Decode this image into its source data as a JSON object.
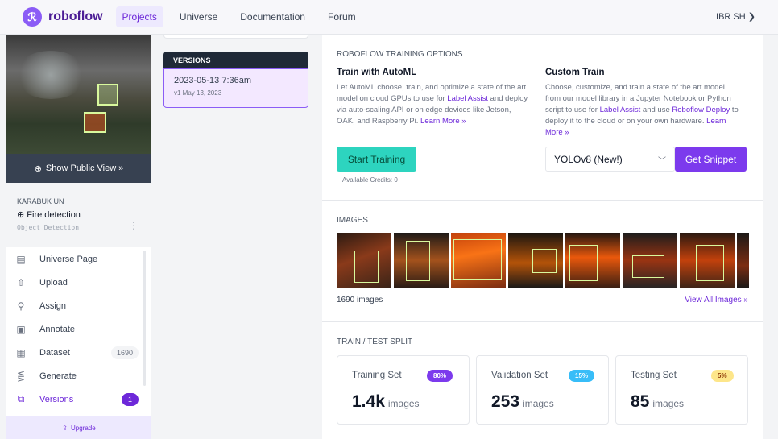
{
  "topbar": {
    "brand": "roboflow",
    "nav": [
      "Projects",
      "Universe",
      "Documentation",
      "Forum"
    ],
    "user": "IBR SH"
  },
  "sidebar": {
    "public_view": "Show Public View »",
    "workspace": "KARABUK UN",
    "project_name": "Fire detection",
    "project_type": "Object Detection",
    "items": [
      {
        "label": "Universe Page",
        "icon": "universe-page-icon"
      },
      {
        "label": "Upload",
        "icon": "upload-icon"
      },
      {
        "label": "Assign",
        "icon": "search-icon"
      },
      {
        "label": "Annotate",
        "icon": "annotate-icon"
      },
      {
        "label": "Dataset",
        "icon": "dataset-icon",
        "count": "1690"
      },
      {
        "label": "Generate",
        "icon": "generate-icon"
      },
      {
        "label": "Versions",
        "icon": "versions-icon",
        "count": "1"
      }
    ],
    "upgrade": "Upgrade"
  },
  "versions": {
    "header": "VERSIONS",
    "items": [
      {
        "date": "2023-05-13 7:36am",
        "sub": "v1 May 13, 2023"
      }
    ]
  },
  "training": {
    "section_title": "ROBOFLOW TRAINING OPTIONS",
    "automl": {
      "title": "Train with AutoML",
      "text_a": "Let AutoML choose, train, and optimize a state of the art model on cloud GPUs to use for ",
      "link_a": "Label Assist",
      "text_b": " and deploy via auto-scaling API or on edge devices like Jetson, OAK, and Raspberry Pi. ",
      "link_b": "Learn More »",
      "button": "Start Training",
      "credits": "Available Credits: 0"
    },
    "custom": {
      "title": "Custom Train",
      "text_a": "Choose, customize, and train a state of the art model from our model library in a Jupyter Notebook or Python script to use for ",
      "link_a": "Label Assist",
      "text_b": " and use ",
      "link_b": "Roboflow Deploy",
      "text_c": " to deploy it to the cloud or on your own hardware. ",
      "link_c": "Learn More »",
      "select": "YOLOv8 (New!)",
      "button": "Get Snippet"
    }
  },
  "images": {
    "section_title": "IMAGES",
    "count": "1690 images",
    "view_all": "View All Images »"
  },
  "split": {
    "section_title": "TRAIN / TEST SPLIT",
    "cards": [
      {
        "label": "Training Set",
        "badge": "80%",
        "value": "1.4k",
        "unit": "images",
        "badge_bg": "#7c3aed",
        "badge_fg": "#ffffff"
      },
      {
        "label": "Validation Set",
        "badge": "15%",
        "value": "253",
        "unit": "images",
        "badge_bg": "#38bdf8",
        "badge_fg": "#ffffff"
      },
      {
        "label": "Testing Set",
        "badge": "5%",
        "value": "85",
        "unit": "images",
        "badge_bg": "#fde68a",
        "badge_fg": "#92400e"
      }
    ]
  },
  "colors": {
    "accent": "#7c3aed",
    "teal": "#2dd4bf"
  }
}
